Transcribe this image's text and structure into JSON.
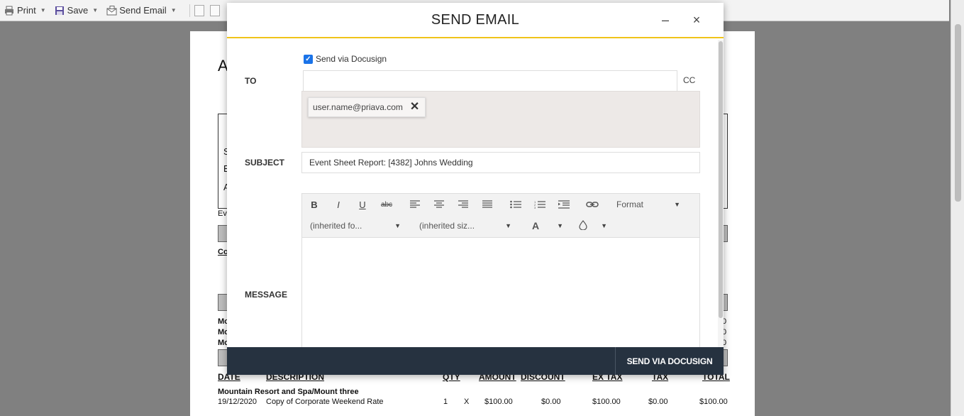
{
  "toolbar": {
    "print_label": "Print",
    "save_label": "Save",
    "send_email_label": "Send Email"
  },
  "modal": {
    "title": "SEND EMAIL",
    "minimize_icon": "–",
    "close_icon": "×",
    "to_label": "TO",
    "docusign_label": "Send via Docusign",
    "docusign_checked": true,
    "to_value": "",
    "cc_label": "CC",
    "recipients": [
      "user.name@priava.com"
    ],
    "subject_label": "SUBJECT",
    "subject_value": "Event Sheet Report: [4382] Johns Wedding",
    "message_label": "MESSAGE",
    "editor": {
      "bold": "B",
      "italic": "I",
      "underline": "U",
      "strike": "abc",
      "format": "Format",
      "font": "(inherited fo...",
      "size": "(inherited siz...",
      "text_color": "A"
    },
    "send_button": "SEND VIA DOCUSIGN"
  },
  "document": {
    "frag_a": "A",
    "frag_s": "S",
    "frag_e": "E",
    "frag_a2": "A",
    "frag_ev": "Ev",
    "frag_co": "Co",
    "frag_mo1": "Mo",
    "frag_mo2": "Mo",
    "frag_mo3": "Mo",
    "frag_zero1": "0",
    "frag_zero2": "0",
    "frag_zero3": "0",
    "columns": [
      "DATE",
      "DESCRIPTION",
      "QTY",
      "AMOUNT",
      "DISCOUNT",
      "EX TAX",
      "TAX",
      "TOTAL"
    ],
    "venue": "Mountain Resort and Spa/Mount three",
    "row": {
      "date": "19/12/2020",
      "description": "Copy of Corporate Weekend Rate",
      "qty": "1",
      "x": "X",
      "amount": "$100.00",
      "discount": "$0.00",
      "ex_tax": "$100.00",
      "tax": "$0.00",
      "total": "$100.00"
    }
  }
}
